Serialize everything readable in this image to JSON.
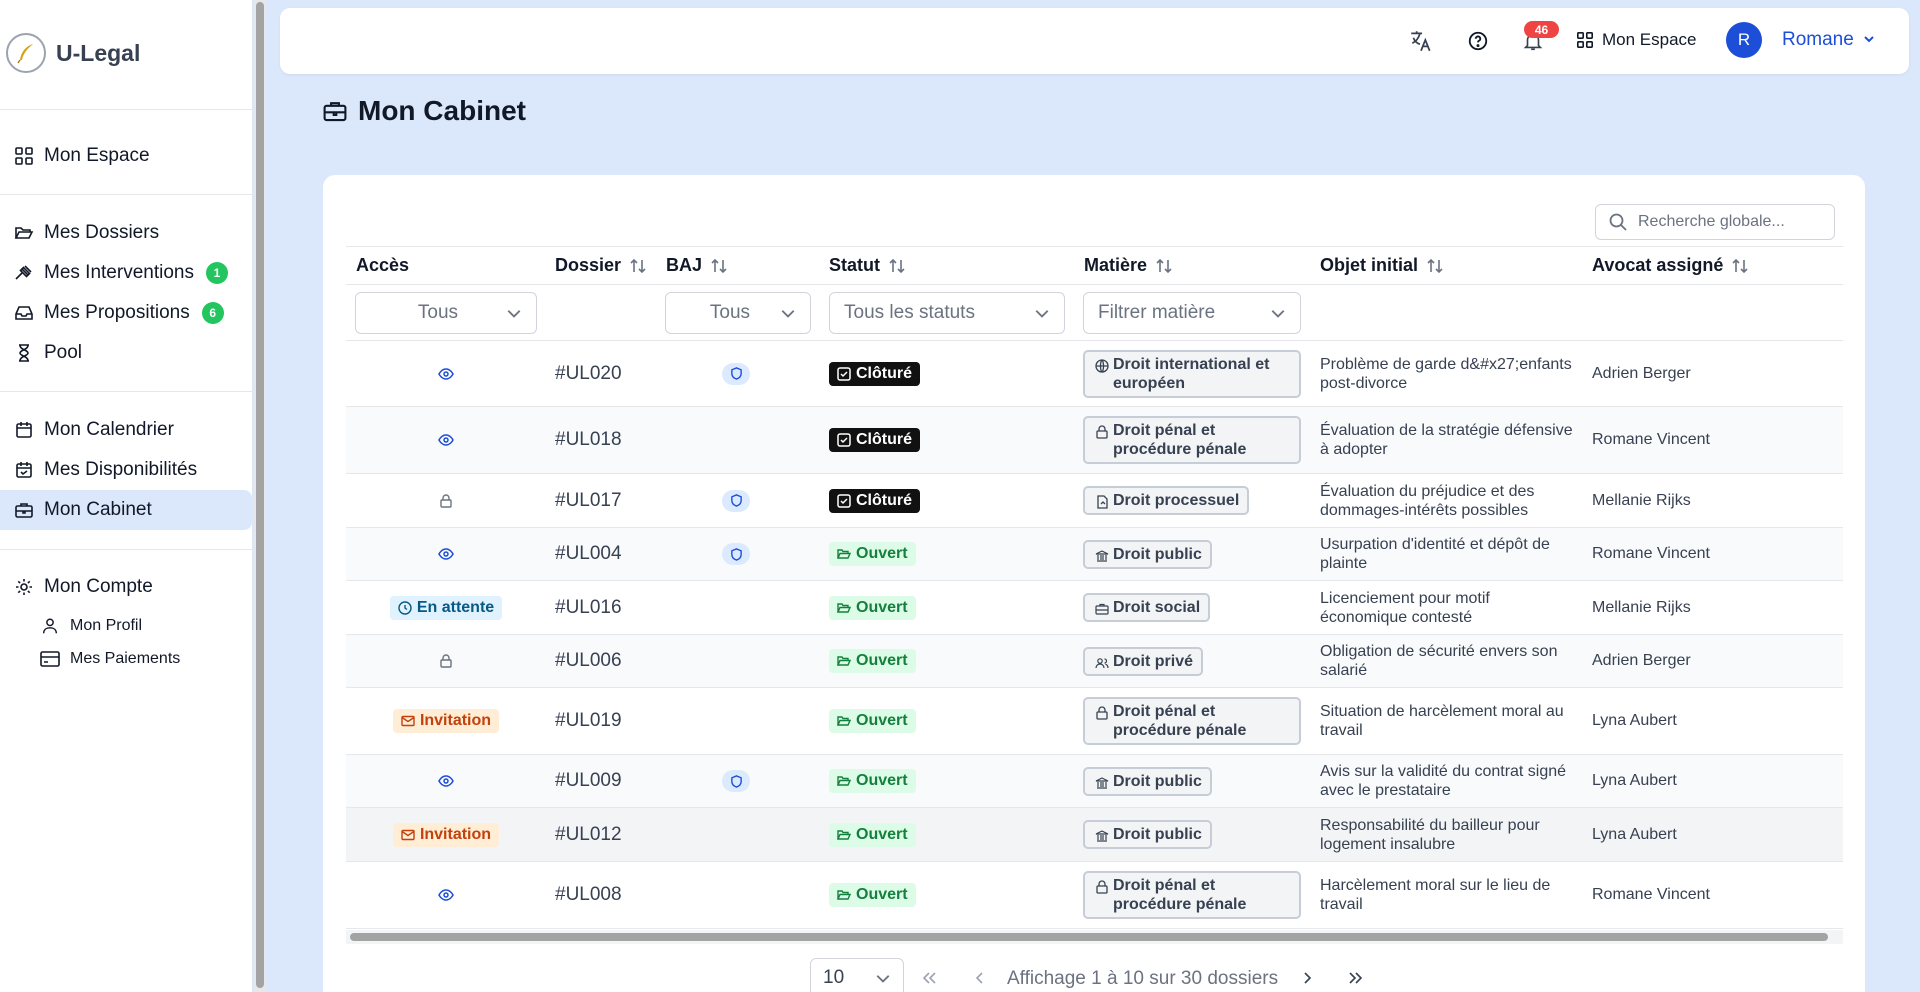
{
  "app": {
    "name": "U-Legal"
  },
  "sidebar": {
    "items": [
      {
        "label": "Mon Espace"
      },
      {
        "label": "Mes Dossiers"
      },
      {
        "label": "Mes Interventions",
        "badge": "1"
      },
      {
        "label": "Mes Propositions",
        "badge": "6"
      },
      {
        "label": "Pool"
      },
      {
        "label": "Mon Calendrier"
      },
      {
        "label": "Mes Disponibilités"
      },
      {
        "label": "Mon Cabinet",
        "active": true
      },
      {
        "label": "Mon Compte"
      }
    ],
    "subitems": [
      {
        "label": "Mon Profil"
      },
      {
        "label": "Mes Paiements"
      }
    ]
  },
  "topbar": {
    "notif_count": "46",
    "espace_label": "Mon Espace",
    "avatar_initial": "R",
    "user_name": "Romane"
  },
  "page": {
    "title": "Mon Cabinet"
  },
  "search": {
    "placeholder": "Recherche globale..."
  },
  "table": {
    "headers": {
      "acces": "Accès",
      "dossier": "Dossier",
      "baj": "BAJ",
      "statut": "Statut",
      "matiere": "Matière",
      "objet": "Objet initial",
      "avocat": "Avocat assigné"
    },
    "filters": {
      "acces": "Tous",
      "baj": "Tous",
      "statut": "Tous les statuts",
      "matiere": "Filtrer matière"
    },
    "rows": [
      {
        "acces": "eye",
        "dossier": "#UL020",
        "baj": true,
        "statut": "Clôturé",
        "matiere": "Droit international et européen",
        "objet": "Problème de garde d&#x27;enfants post-divorce",
        "avocat": "Adrien Berger"
      },
      {
        "acces": "eye",
        "dossier": "#UL018",
        "baj": false,
        "statut": "Clôturé",
        "matiere": "Droit pénal et procédure pénale",
        "objet": "Évaluation de la stratégie défensive à adopter",
        "avocat": "Romane Vincent"
      },
      {
        "acces": "lock",
        "dossier": "#UL017",
        "baj": true,
        "statut": "Clôturé",
        "matiere": "Droit processuel",
        "objet": "Évaluation du préjudice et des dommages-intérêts possibles",
        "avocat": "Mellanie Rijks"
      },
      {
        "acces": "eye",
        "dossier": "#UL004",
        "baj": true,
        "statut": "Ouvert",
        "matiere": "Droit public",
        "objet": "Usurpation d'identité et dépôt de plainte",
        "avocat": "Romane Vincent"
      },
      {
        "acces": "En attente",
        "dossier": "#UL016",
        "baj": false,
        "statut": "Ouvert",
        "matiere": "Droit social",
        "objet": "Licenciement pour motif économique contesté",
        "avocat": "Mellanie Rijks"
      },
      {
        "acces": "lock",
        "dossier": "#UL006",
        "baj": false,
        "statut": "Ouvert",
        "matiere": "Droit privé",
        "objet": "Obligation de sécurité envers son salarié",
        "avocat": "Adrien Berger"
      },
      {
        "acces": "Invitation",
        "dossier": "#UL019",
        "baj": false,
        "statut": "Ouvert",
        "matiere": "Droit pénal et procédure pénale",
        "objet": "Situation de harcèlement moral au travail",
        "avocat": "Lyna Aubert"
      },
      {
        "acces": "eye",
        "dossier": "#UL009",
        "baj": true,
        "statut": "Ouvert",
        "matiere": "Droit public",
        "objet": "Avis sur la validité du contrat signé avec le prestataire",
        "avocat": "Lyna Aubert"
      },
      {
        "acces": "Invitation",
        "dossier": "#UL012",
        "baj": false,
        "statut": "Ouvert",
        "matiere": "Droit public",
        "objet": "Responsabilité du bailleur pour logement insalubre",
        "avocat": "Lyna Aubert"
      },
      {
        "acces": "eye",
        "dossier": "#UL008",
        "baj": false,
        "statut": "Ouvert",
        "matiere": "Droit pénal et procédure pénale",
        "objet": "Harcèlement moral sur le lieu de travail",
        "avocat": "Romane Vincent"
      }
    ]
  },
  "pagination": {
    "page_size": "10",
    "summary": "Affichage 1 à 10 sur 30 dossiers"
  }
}
